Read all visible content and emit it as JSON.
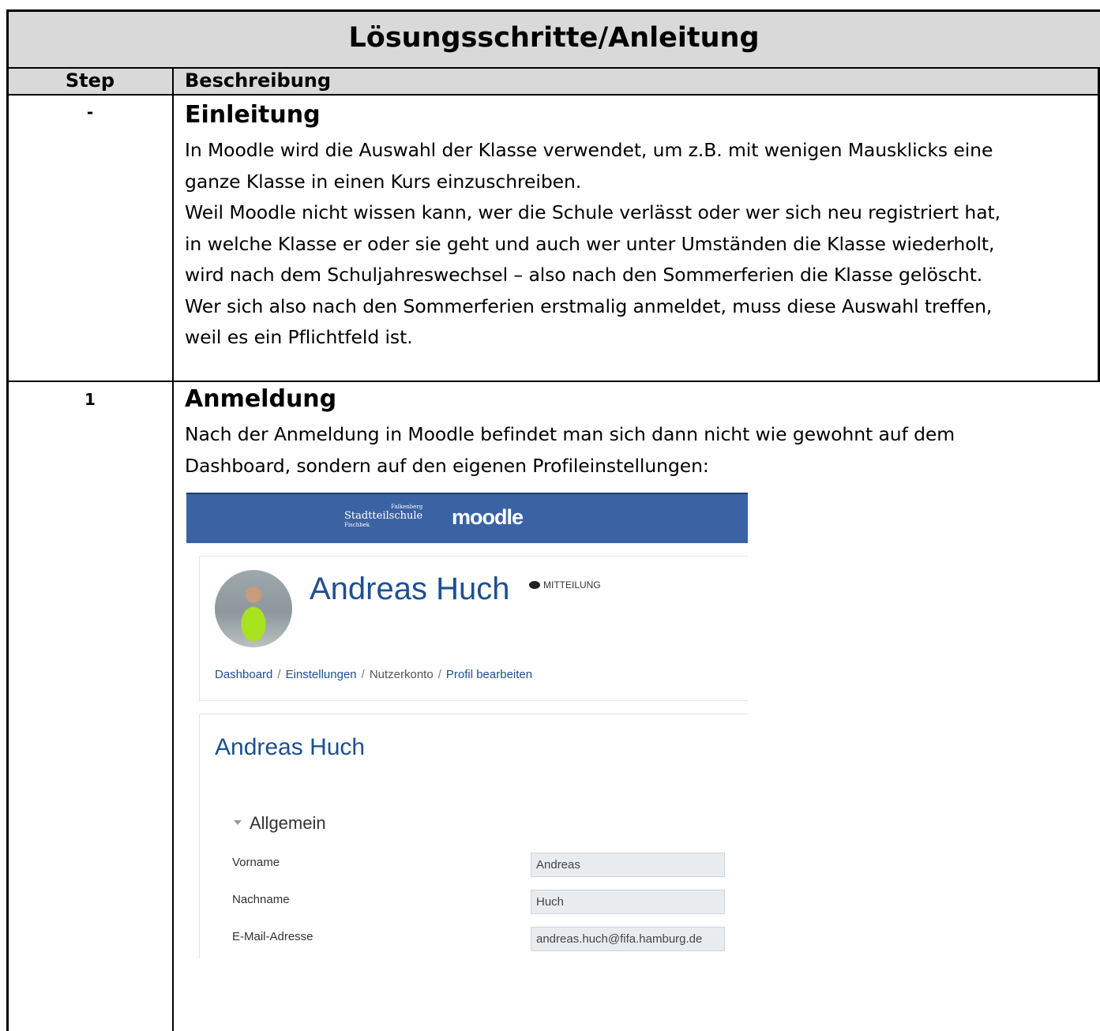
{
  "title": "Lösungsschritte/Anleitung",
  "columns": {
    "step": "Step",
    "description": "Beschreibung"
  },
  "rows": [
    {
      "step": "-",
      "heading": "Einleitung",
      "lines": [
        "In Moodle wird die Auswahl der Klasse verwendet, um z.B. mit wenigen Mausklicks eine",
        "ganze Klasse in einen Kurs einzuschreiben.",
        "Weil Moodle nicht wissen kann, wer die Schule verlässt oder wer sich neu registriert hat,",
        "in welche Klasse er oder sie geht und auch wer unter Umständen die Klasse wiederholt,",
        "wird nach dem Schuljahreswechsel – also nach den Sommerferien die Klasse gelöscht.",
        "Wer sich also nach den Sommerferien erstmalig anmeldet, muss diese Auswahl treffen,",
        "weil es ein Pflichtfeld ist."
      ]
    },
    {
      "step": "1",
      "heading": "Anmeldung",
      "lines": [
        "Nach der Anmeldung in Moodle befindet man sich dann nicht wie gewohnt auf dem",
        "Dashboard, sondern auf den eigenen Profileinstellungen:"
      ]
    }
  ],
  "screenshot": {
    "school_logo_top": "Falkenberg",
    "school_logo": "Stadtteilschule",
    "school_logo_sub": "Fischbek",
    "moodle_logo": "moodle",
    "profile_name": "Andreas Huch",
    "message_label": "MITTEILUNG",
    "breadcrumb": [
      "Dashboard",
      "Einstellungen",
      "Nutzerkonto",
      "Profil bearbeiten"
    ],
    "form_heading": "Andreas Huch",
    "section_label": "Allgemein",
    "fields": [
      {
        "label": "Vorname",
        "value": "Andreas"
      },
      {
        "label": "Nachname",
        "value": "Huch"
      },
      {
        "label": "E-Mail-Adresse",
        "value": "andreas.huch@fifa.hamburg.de"
      }
    ]
  }
}
